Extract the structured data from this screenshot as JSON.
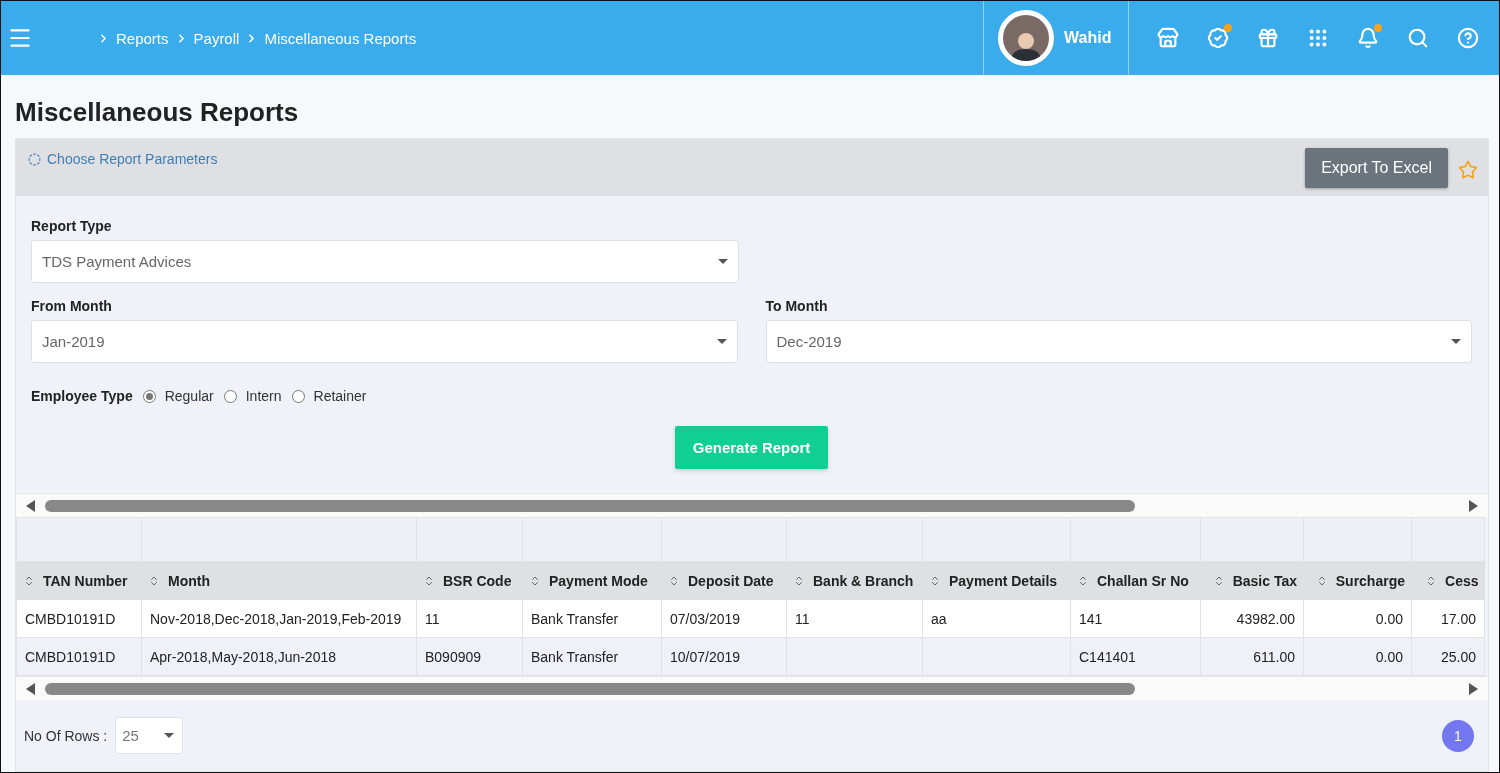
{
  "header": {
    "breadcrumb": [
      "Reports",
      "Payroll",
      "Miscellaneous Reports"
    ],
    "user": {
      "name": "Wahid"
    },
    "icons": [
      {
        "kind": "store",
        "dot": false
      },
      {
        "kind": "verified",
        "dot": true
      },
      {
        "kind": "gift",
        "dot": false
      },
      {
        "kind": "apps",
        "dot": false
      },
      {
        "kind": "bell",
        "dot": true
      },
      {
        "kind": "search",
        "dot": false
      },
      {
        "kind": "help",
        "dot": false
      }
    ]
  },
  "page_title": "Miscellaneous Reports",
  "panel": {
    "title": "Choose Report Parameters",
    "export_button": "Export To Excel",
    "favorite": false
  },
  "form": {
    "report_type": {
      "label": "Report Type",
      "value": "TDS Payment Advices"
    },
    "from_month": {
      "label": "From Month",
      "value": "Jan-2019"
    },
    "to_month": {
      "label": "To Month",
      "value": "Dec-2019"
    },
    "employee_type": {
      "label": "Employee Type",
      "options": [
        {
          "label": "Regular",
          "selected": true
        },
        {
          "label": "Intern",
          "selected": false
        },
        {
          "label": "Retainer",
          "selected": false
        }
      ]
    },
    "generate_button": "Generate Report"
  },
  "table": {
    "columns": [
      {
        "label": "TAN Number",
        "kind": "text"
      },
      {
        "label": "Month",
        "kind": "text"
      },
      {
        "label": "BSR Code",
        "kind": "text"
      },
      {
        "label": "Payment Mode",
        "kind": "text"
      },
      {
        "label": "Deposit Date",
        "kind": "text"
      },
      {
        "label": "Bank & Branch",
        "kind": "text"
      },
      {
        "label": "Payment Details",
        "kind": "text"
      },
      {
        "label": "Challan Sr No",
        "kind": "text"
      },
      {
        "label": "Basic Tax",
        "kind": "amount"
      },
      {
        "label": "Surcharge",
        "kind": "amount"
      },
      {
        "label": "Cess",
        "kind": "amount"
      }
    ],
    "rows": [
      [
        "CMBD10191D",
        "Nov-2018,Dec-2018,Jan-2019,Feb-2019",
        "11",
        "Bank Transfer",
        "07/03/2019",
        "11",
        "aa",
        "141",
        "43982.00",
        "0.00",
        "17.00"
      ],
      [
        "CMBD10191D",
        "Apr-2018,May-2018,Jun-2018",
        "B090909",
        "Bank Transfer",
        "10/07/2019",
        "",
        "",
        "C141401",
        "611.00",
        "0.00",
        "25.00"
      ]
    ]
  },
  "footer": {
    "rows_label": "No Of Rows :",
    "rows_value": "25",
    "pages": [
      {
        "label": "1",
        "selected": true
      }
    ]
  }
}
